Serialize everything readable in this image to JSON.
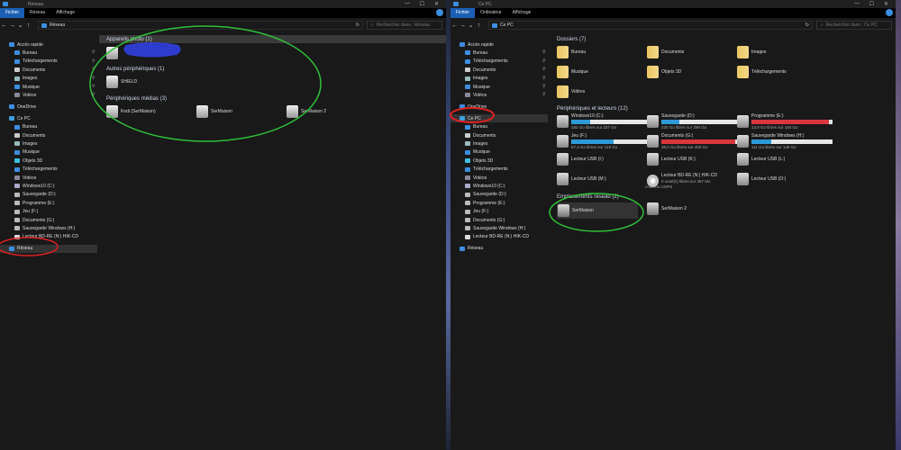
{
  "left": {
    "title": "Réseau",
    "ribbon": [
      "Fichier",
      "Réseau",
      "Affichage"
    ],
    "path": "Réseau",
    "search_placeholder": "Rechercher dans : Réseau",
    "sidebar": [
      {
        "label": "Accès rapide",
        "icon": "star-icon",
        "lvl": 0,
        "c": "#3c8ee0"
      },
      {
        "label": "Bureau",
        "icon": "desktop-icon",
        "lvl": 1,
        "c": "#3c8ee0",
        "pin": true
      },
      {
        "label": "Téléchargements",
        "icon": "download-icon",
        "lvl": 1,
        "c": "#3c8ee0",
        "pin": true
      },
      {
        "label": "Documents",
        "icon": "document-icon",
        "lvl": 1,
        "c": "#ccc",
        "pin": true
      },
      {
        "label": "Images",
        "icon": "image-icon",
        "lvl": 1,
        "c": "#9bb",
        "pin": true
      },
      {
        "label": "Musique",
        "icon": "music-icon",
        "lvl": 1,
        "c": "#3c8ee0",
        "pin": true
      },
      {
        "label": "Vidéos",
        "icon": "video-icon",
        "lvl": 1,
        "c": "#889",
        "pin": true
      },
      {
        "label": "OneDrive",
        "icon": "cloud-icon",
        "lvl": 0,
        "c": "#3c8ee0",
        "gap": true
      },
      {
        "label": "Ce PC",
        "icon": "computer-icon",
        "lvl": 0,
        "c": "#3c9ee0",
        "gap": true
      },
      {
        "label": "Bureau",
        "icon": "desktop-icon",
        "lvl": 1,
        "c": "#3c8ee0"
      },
      {
        "label": "Documents",
        "icon": "document-icon",
        "lvl": 1,
        "c": "#ccc"
      },
      {
        "label": "Images",
        "icon": "image-icon",
        "lvl": 1,
        "c": "#9bb"
      },
      {
        "label": "Musique",
        "icon": "music-icon",
        "lvl": 1,
        "c": "#3c8ee0"
      },
      {
        "label": "Objets 3D",
        "icon": "cube-icon",
        "lvl": 1,
        "c": "#3cc0e0"
      },
      {
        "label": "Téléchargements",
        "icon": "download-icon",
        "lvl": 1,
        "c": "#3c8ee0"
      },
      {
        "label": "Vidéos",
        "icon": "video-icon",
        "lvl": 1,
        "c": "#889"
      },
      {
        "label": "Windows10 (C:)",
        "icon": "drive-icon",
        "lvl": 1,
        "c": "#aac"
      },
      {
        "label": "Sauvegarde (D:)",
        "icon": "drive-icon",
        "lvl": 1,
        "c": "#bbb"
      },
      {
        "label": "Programme (E:)",
        "icon": "drive-icon",
        "lvl": 1,
        "c": "#bbb"
      },
      {
        "label": "Jeu (F:)",
        "icon": "drive-icon",
        "lvl": 1,
        "c": "#bbb"
      },
      {
        "label": "Documents (G:)",
        "icon": "drive-icon",
        "lvl": 1,
        "c": "#bbb"
      },
      {
        "label": "Sauvegarde Windows (H:)",
        "icon": "drive-icon",
        "lvl": 1,
        "c": "#bbb"
      },
      {
        "label": "Lecteur BD-RE (N:) HIK-CD",
        "icon": "disc-icon",
        "lvl": 1,
        "c": "#ddd"
      },
      {
        "label": "Réseau",
        "icon": "network-icon",
        "lvl": 0,
        "c": "#3c8ee0",
        "gap": true,
        "sel": true
      }
    ],
    "groups": [
      {
        "header": "Appareils photo (1)",
        "items": [
          {
            "label": "",
            "icon": "camera-icon",
            "c": "#ccc"
          }
        ]
      },
      {
        "header": "Autres périphériques (1)",
        "items": [
          {
            "label": "SHIELD",
            "icon": "device-icon",
            "c": "#ddd"
          }
        ]
      },
      {
        "header": "Périphériques médias (3)",
        "items": [
          {
            "label": "Kodi (SerMaison)",
            "icon": "media-server-icon",
            "c": "#ddd"
          },
          {
            "label": "SerMaison",
            "icon": "media-server-icon",
            "c": "#ddd"
          },
          {
            "label": "SerMaison 2",
            "icon": "media-server-icon",
            "c": "#ddd"
          }
        ]
      }
    ]
  },
  "right": {
    "title": "Ce PC",
    "ribbon": [
      "Fichier",
      "Ordinateur",
      "Affichage"
    ],
    "path": "Ce PC",
    "search_placeholder": "Rechercher dans : Ce PC",
    "sidebar": [
      {
        "label": "Accès rapide",
        "icon": "star-icon",
        "lvl": 0,
        "c": "#3c8ee0"
      },
      {
        "label": "Bureau",
        "icon": "desktop-icon",
        "lvl": 1,
        "c": "#3c8ee0",
        "pin": true
      },
      {
        "label": "Téléchargements",
        "icon": "download-icon",
        "lvl": 1,
        "c": "#3c8ee0",
        "pin": true
      },
      {
        "label": "Documents",
        "icon": "document-icon",
        "lvl": 1,
        "c": "#ccc",
        "pin": true
      },
      {
        "label": "Images",
        "icon": "image-icon",
        "lvl": 1,
        "c": "#9bb",
        "pin": true
      },
      {
        "label": "Musique",
        "icon": "music-icon",
        "lvl": 1,
        "c": "#3c8ee0",
        "pin": true
      },
      {
        "label": "Vidéos",
        "icon": "video-icon",
        "lvl": 1,
        "c": "#889",
        "pin": true
      },
      {
        "label": "OneDrive",
        "icon": "cloud-icon",
        "lvl": 0,
        "c": "#3c8ee0",
        "gap": true
      },
      {
        "label": "Ce PC",
        "icon": "computer-icon",
        "lvl": 0,
        "c": "#3c9ee0",
        "gap": true,
        "sel": true
      },
      {
        "label": "Bureau",
        "icon": "desktop-icon",
        "lvl": 1,
        "c": "#3c8ee0"
      },
      {
        "label": "Documents",
        "icon": "document-icon",
        "lvl": 1,
        "c": "#ccc"
      },
      {
        "label": "Images",
        "icon": "image-icon",
        "lvl": 1,
        "c": "#9bb"
      },
      {
        "label": "Musique",
        "icon": "music-icon",
        "lvl": 1,
        "c": "#3c8ee0"
      },
      {
        "label": "Objets 3D",
        "icon": "cube-icon",
        "lvl": 1,
        "c": "#3cc0e0"
      },
      {
        "label": "Téléchargements",
        "icon": "download-icon",
        "lvl": 1,
        "c": "#3c8ee0"
      },
      {
        "label": "Vidéos",
        "icon": "video-icon",
        "lvl": 1,
        "c": "#889"
      },
      {
        "label": "Windows10 (C:)",
        "icon": "drive-icon",
        "lvl": 1,
        "c": "#aac"
      },
      {
        "label": "Sauvegarde (D:)",
        "icon": "drive-icon",
        "lvl": 1,
        "c": "#bbb"
      },
      {
        "label": "Programme (E:)",
        "icon": "drive-icon",
        "lvl": 1,
        "c": "#bbb"
      },
      {
        "label": "Jeu (F:)",
        "icon": "drive-icon",
        "lvl": 1,
        "c": "#bbb"
      },
      {
        "label": "Documents (G:)",
        "icon": "drive-icon",
        "lvl": 1,
        "c": "#bbb"
      },
      {
        "label": "Sauvegarde Windows (H:)",
        "icon": "drive-icon",
        "lvl": 1,
        "c": "#bbb"
      },
      {
        "label": "Lecteur BD-RE (N:) HIK-CD",
        "icon": "disc-icon",
        "lvl": 1,
        "c": "#ddd"
      },
      {
        "label": "Réseau",
        "icon": "network-icon",
        "lvl": 0,
        "c": "#3c8ee0",
        "gap": true
      }
    ],
    "folders_header": "Dossiers (7)",
    "folders": [
      "Bureau",
      "Documents",
      "Images",
      "Musique",
      "Objets 3D",
      "Téléchargements",
      "Vidéos"
    ],
    "drives_header": "Périphériques et lecteurs (12)",
    "drives": [
      {
        "label": "Windows10 (C:)",
        "sub": "182 Go libres sur 237 Go",
        "used": 0.23,
        "color": "#2f9ad8",
        "icon": "windows-drive-icon"
      },
      {
        "label": "Sauvegarde (D:)",
        "sub": "220 Go libres sur 290 Go",
        "used": 0.22,
        "color": "#2f9ad8",
        "icon": "drive-icon"
      },
      {
        "label": "Programme (E:)",
        "sub": "13,9 Go libres sur 184 Go",
        "used": 0.96,
        "color": "#d9363e",
        "icon": "drive-icon"
      },
      {
        "label": "Jeu (F:)",
        "sub": "57,3 Go libres sur 119 Go",
        "used": 0.52,
        "color": "#2f9ad8",
        "icon": "drive-icon"
      },
      {
        "label": "Documents (G:)",
        "sub": "38,0 Go libres sur 400 Go",
        "used": 0.91,
        "color": "#d9363e",
        "icon": "drive-icon"
      },
      {
        "label": "Sauvegarde Windows (H:)",
        "sub": "111 Go libres sur 148 Go",
        "used": 0.24,
        "color": "#2f9ad8",
        "icon": "drive-icon"
      },
      {
        "label": "Lecteur USB (I:)",
        "icon": "usb-drive-icon"
      },
      {
        "label": "Lecteur USB (K:)",
        "icon": "usb-drive-icon"
      },
      {
        "label": "Lecteur USB (L:)",
        "icon": "usb-drive-icon"
      },
      {
        "label": "Lecteur USB (M:)",
        "icon": "usb-drive-icon"
      },
      {
        "label": "Lecteur BD-RE (N:) HIK-CD",
        "sub": "0 octet(s) libres sur 457 Mo",
        "sub2": "CDFS",
        "icon": "disc-icon",
        "disc_label": "DVD-ROM"
      },
      {
        "label": "Lecteur USB (O:)",
        "icon": "usb-drive-icon"
      }
    ],
    "network_header": "Emplacements réseau (2)",
    "network": [
      "SerMaison",
      "SerMaison 2"
    ]
  }
}
